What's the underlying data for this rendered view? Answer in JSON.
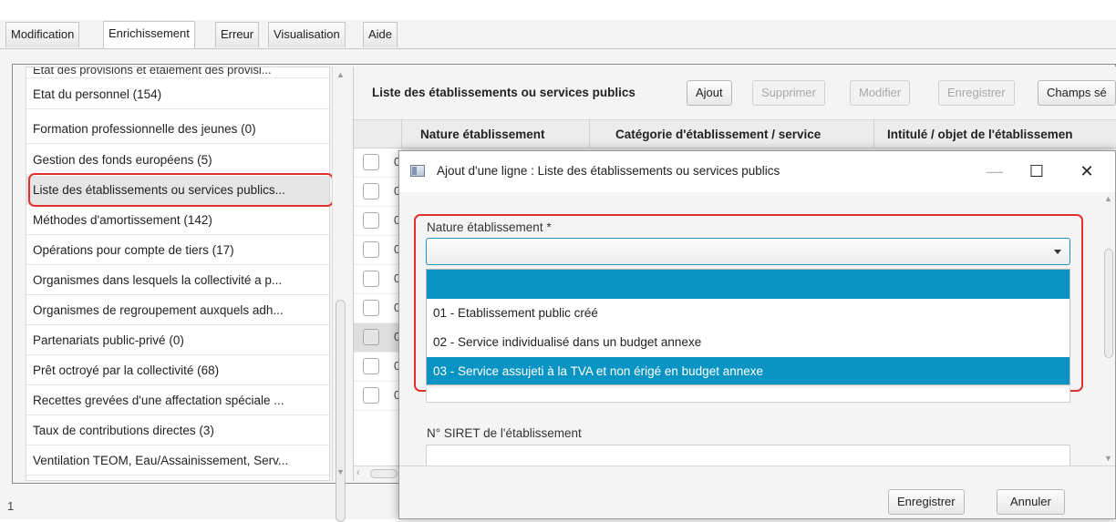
{
  "tabs": [
    {
      "label": "Modification"
    },
    {
      "label": "Enrichissement"
    },
    {
      "label": "Erreur"
    },
    {
      "label": "Visualisation"
    },
    {
      "label": "Aide"
    }
  ],
  "left_list": {
    "items": [
      {
        "label": "Etat des provisions et étalement des provisi..."
      },
      {
        "label": "Etat du personnel (154)"
      },
      {
        "label": "Formation professionnelle des jeunes (0)"
      },
      {
        "label": "Gestion des fonds européens (5)"
      },
      {
        "label": "Liste des établissements ou services publics..."
      },
      {
        "label": "Méthodes d'amortissement (142)"
      },
      {
        "label": "Opérations pour compte de tiers (17)"
      },
      {
        "label": "Organismes dans lesquels la collectivité a p..."
      },
      {
        "label": "Organismes de regroupement auxquels adh..."
      },
      {
        "label": "Partenariats public-privé (0)"
      },
      {
        "label": "Prêt octroyé par la collectivité (68)"
      },
      {
        "label": "Recettes grevées d'une affectation spéciale ..."
      },
      {
        "label": "Taux de contributions directes (3)"
      },
      {
        "label": "Ventilation TEOM, Eau/Assainissement, Serv..."
      }
    ]
  },
  "panel": {
    "title": "Liste des établissements ou services publics",
    "buttons": {
      "add": "Ajout",
      "delete": "Supprimer",
      "modify": "Modifier",
      "save": "Enregistrer",
      "fields": "Champs sé"
    },
    "columns": [
      {
        "label": "Nature établissement"
      },
      {
        "label": "Catégorie d'établissement / service"
      },
      {
        "label": "Intitulé / objet de l'établissemen"
      }
    ],
    "row_prefix": "0",
    "footer_text": "1"
  },
  "dialog": {
    "title": "Ajout d'une ligne : Liste des établissements ou services publics",
    "minimize": "—",
    "maximize": "☐",
    "close": "✕",
    "nature_label": "Nature établissement  *",
    "options": [
      {
        "label": ""
      },
      {
        "label": "01 - Etablissement public créé"
      },
      {
        "label": "02 - Service individualisé dans un budget annexe"
      },
      {
        "label": "03 - Service assujeti à la TVA et non érigé en budget annexe"
      }
    ],
    "siret_label": "N° SIRET de l'établissement",
    "save_button": "Enregistrer",
    "cancel_button": "Annuler"
  },
  "colors": {
    "accent": "#0a94c4",
    "highlight_border": "#e0322d"
  }
}
